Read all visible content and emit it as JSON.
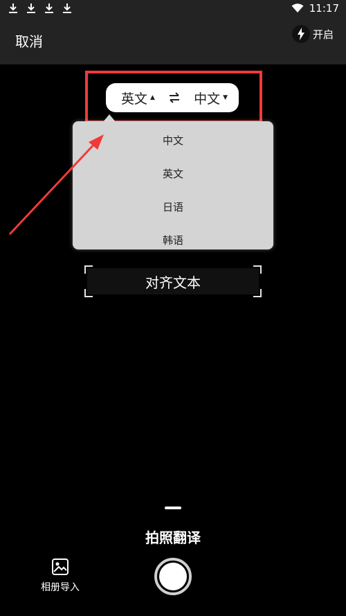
{
  "status_bar": {
    "time": "11:17",
    "download_icons": [
      "download-icon",
      "download-icon",
      "download-icon",
      "download-icon"
    ],
    "wifi_icon": "wifi-icon"
  },
  "header": {
    "cancel_label": "取消",
    "flash_label": "开启",
    "flash_icon": "lightning-icon"
  },
  "language_selector": {
    "source": "英文",
    "target": "中文",
    "swap_icon": "swap-icon",
    "highlight_color": "#f03a3a"
  },
  "dropdown": {
    "options": [
      "中文",
      "英文",
      "日语",
      "韩语"
    ]
  },
  "align_frame": {
    "label": "对齐文本"
  },
  "bottom": {
    "mode_label": "拍照翻译",
    "album_label": "相册导入",
    "album_icon": "image-icon",
    "shutter_icon": "shutter-button"
  }
}
